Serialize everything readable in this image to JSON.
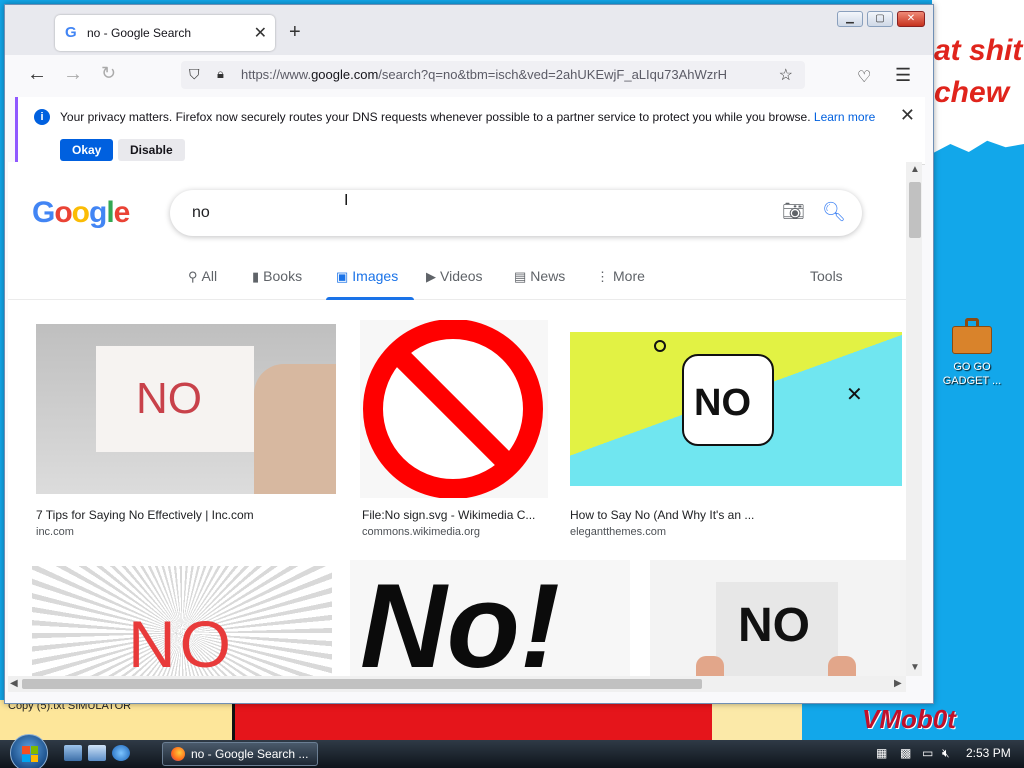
{
  "desktop": {
    "wallpaper_text_1": "at shit",
    "wallpaper_text_2": "chew",
    "wallpaper_logo": "VMob0t",
    "wallpaper_small": "Copy (5).txt     SIMULATOR",
    "icon_label": "GO GO GADGET ..."
  },
  "browser": {
    "tab_title": "no - Google Search",
    "new_tab": "+",
    "url_prefix": "https://www.",
    "url_domain": "google.com",
    "url_rest": "/search?q=no&tbm=isch&ved=2ahUKEwjF_aLIqu73AhWzrH",
    "notification": {
      "message": "Your privacy matters. Firefox now securely routes your DNS requests whenever possible to a partner service to protect you while you browse.",
      "learn_more": "Learn more",
      "okay": "Okay",
      "disable": "Disable"
    }
  },
  "google": {
    "query": "no",
    "tabs": [
      {
        "label": "All",
        "icon": "search-icon"
      },
      {
        "label": "Books",
        "icon": "book-icon"
      },
      {
        "label": "Images",
        "icon": "image-icon"
      },
      {
        "label": "Videos",
        "icon": "video-icon"
      },
      {
        "label": "News",
        "icon": "news-icon"
      },
      {
        "label": "More",
        "icon": "more-dots-icon"
      }
    ],
    "tools": "Tools",
    "results": [
      {
        "title": "7 Tips for Saying No Effectively | Inc.com",
        "source": "inc.com",
        "thumb_text": "NO"
      },
      {
        "title": "File:No sign.svg - Wikimedia C...",
        "source": "commons.wikimedia.org",
        "thumb_text": ""
      },
      {
        "title": "How to Say No (And Why It's an ...",
        "source": "elegantthemes.com",
        "thumb_text": "NO"
      },
      {
        "title": "",
        "source": "",
        "thumb_text": "NO"
      },
      {
        "title": "",
        "source": "",
        "thumb_text": "No!"
      },
      {
        "title": "",
        "source": "",
        "thumb_text": "NO"
      }
    ]
  },
  "taskbar": {
    "active_window": "no - Google Search ...",
    "clock": "2:53 PM"
  },
  "colors": {
    "google_blue": "#4285f4",
    "google_red": "#ea4335",
    "google_yellow": "#fbbc05",
    "google_green": "#34a853",
    "firefox_accent": "#0060df"
  }
}
